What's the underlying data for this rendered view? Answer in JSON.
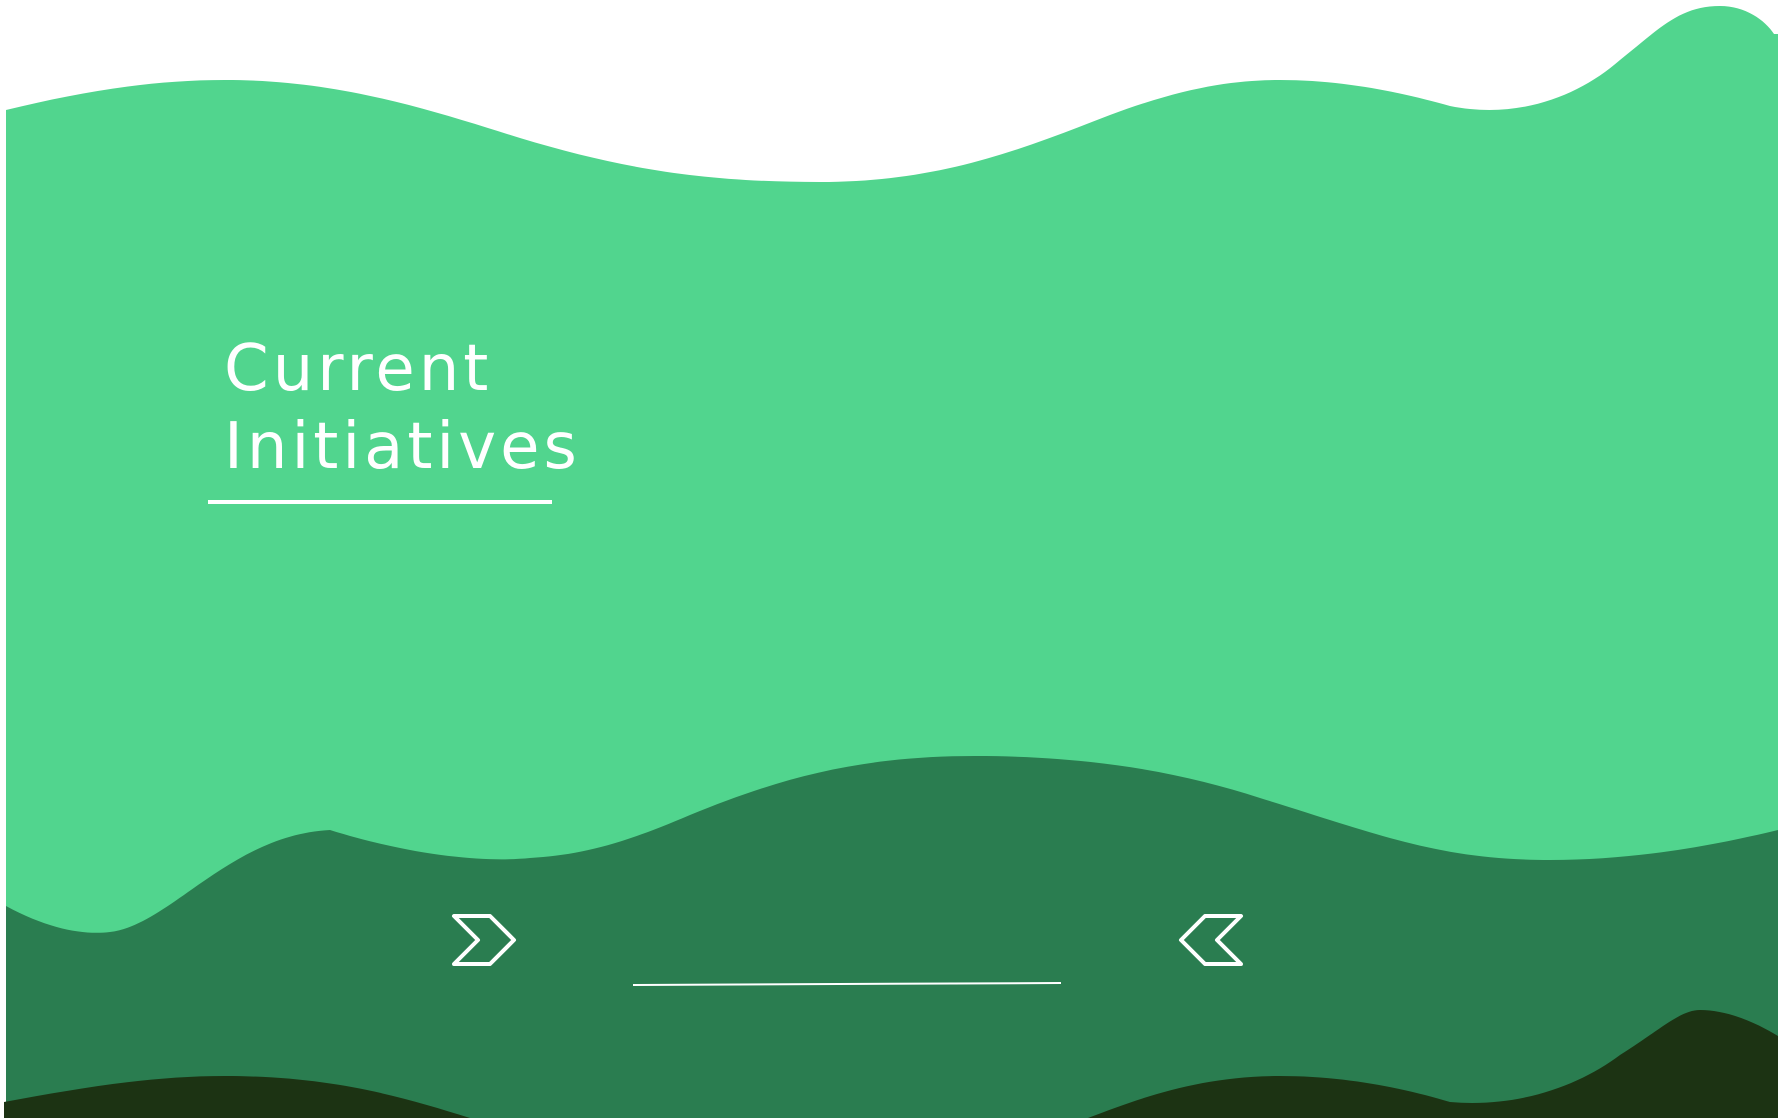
{
  "section": {
    "title_line_1": "Current",
    "title_line_2": "Initiatives"
  },
  "carousel": {
    "next_icon": "double-chevron-right-icon",
    "prev_icon": "double-chevron-left-icon",
    "progress": 0
  },
  "colors": {
    "background": "#ffffff",
    "light_green": "#51d58e",
    "mid_green": "#2a7d50",
    "dark_green": "#1c3313",
    "text": "#ffffff"
  }
}
